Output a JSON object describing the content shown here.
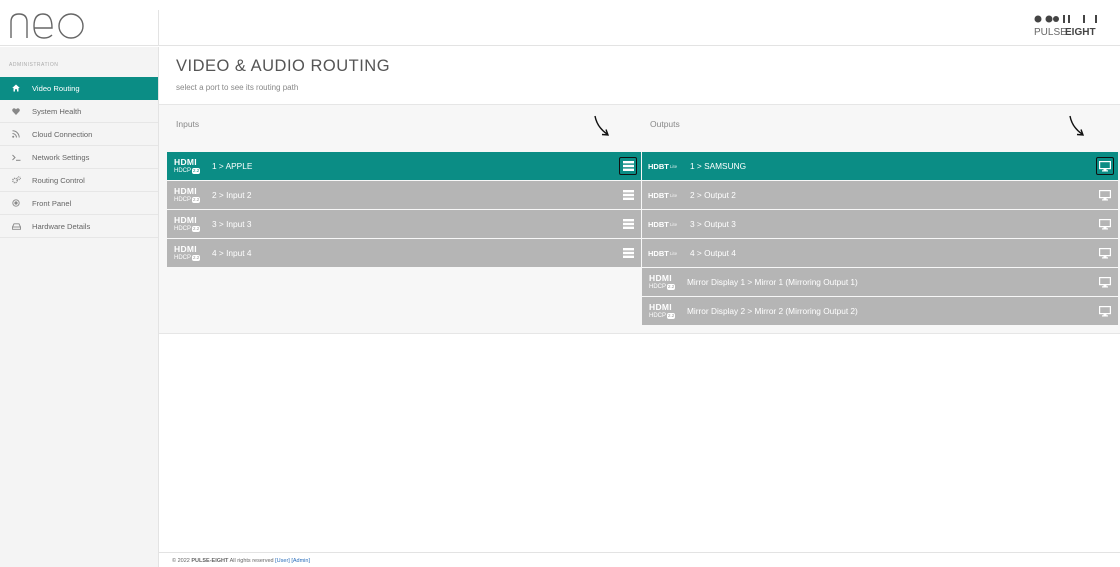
{
  "app": {
    "logo_text": "neo",
    "brand": "PULSE EIGHT",
    "brand_light": "PULSE",
    "brand_bold": "EIGHT"
  },
  "sidebar": {
    "heading": "ADMINISTRATION",
    "items": [
      {
        "label": "Video Routing",
        "icon": "home-icon",
        "active": true
      },
      {
        "label": "System Health",
        "icon": "heart-icon",
        "active": false
      },
      {
        "label": "Cloud Connection",
        "icon": "rss-icon",
        "active": false
      },
      {
        "label": "Network Settings",
        "icon": "terminal-icon",
        "active": false
      },
      {
        "label": "Routing Control",
        "icon": "cogs-icon",
        "active": false
      },
      {
        "label": "Front Panel",
        "icon": "record-icon",
        "active": false
      },
      {
        "label": "Hardware Details",
        "icon": "hdd-icon",
        "active": false
      }
    ]
  },
  "main": {
    "title": "VIDEO & AUDIO ROUTING",
    "subtitle": "select a port to see its routing path",
    "inputs_heading": "Inputs",
    "outputs_heading": "Outputs"
  },
  "inputs": [
    {
      "logo_top": "HDMI",
      "logo_bottom": "HDCP",
      "badge": "2.2",
      "label": "1 > APPLE",
      "active": true,
      "icon": "list-icon"
    },
    {
      "logo_top": "HDMI",
      "logo_bottom": "HDCP",
      "badge": "2.2",
      "label": "2 > Input 2",
      "active": false,
      "icon": "list-icon"
    },
    {
      "logo_top": "HDMI",
      "logo_bottom": "HDCP",
      "badge": "2.2",
      "label": "3 > Input 3",
      "active": false,
      "icon": "list-icon"
    },
    {
      "logo_top": "HDMI",
      "logo_bottom": "HDCP",
      "badge": "2.2",
      "label": "4 > Input 4",
      "active": false,
      "icon": "list-icon"
    }
  ],
  "outputs": [
    {
      "logo": "HDBT",
      "logo_sub": "Lite",
      "label": "1 > SAMSUNG",
      "active": true,
      "icon": "monitor-icon"
    },
    {
      "logo": "HDBT",
      "logo_sub": "Lite",
      "label": "2 > Output 2",
      "active": false,
      "icon": "monitor-icon"
    },
    {
      "logo": "HDBT",
      "logo_sub": "Lite",
      "label": "3 > Output 3",
      "active": false,
      "icon": "monitor-icon"
    },
    {
      "logo": "HDBT",
      "logo_sub": "Lite",
      "label": "4 > Output 4",
      "active": false,
      "icon": "monitor-icon"
    },
    {
      "logo_top": "HDMI",
      "logo_bottom": "HDCP",
      "badge": "2.2",
      "label": "Mirror Display 1 > Mirror 1 (Mirroring Output 1)",
      "active": false,
      "icon": "monitor-icon"
    },
    {
      "logo_top": "HDMI",
      "logo_bottom": "HDCP",
      "badge": "2.2",
      "label": "Mirror Display 2 > Mirror 2 (Mirroring Output 2)",
      "active": false,
      "icon": "monitor-icon"
    }
  ],
  "footer": {
    "prefix": "© 2022",
    "company": "PULSE-EIGHT",
    "rights": "All rights reserved",
    "user_link": "[User]",
    "admin_link": "[Admin]"
  },
  "colors": {
    "accent": "#0b8d85",
    "row_inactive": "#b5b5b5"
  }
}
